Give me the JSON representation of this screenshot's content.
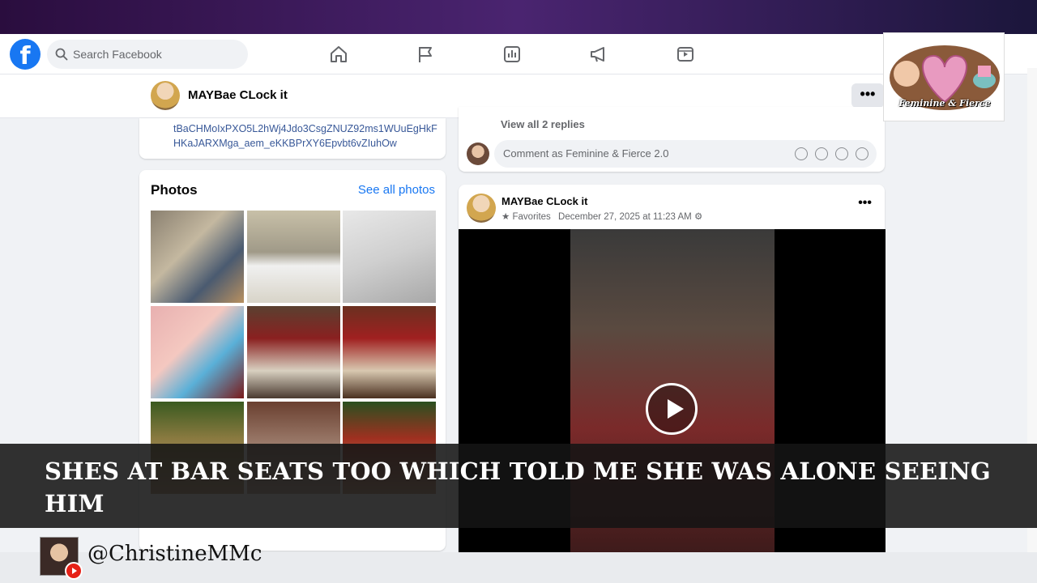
{
  "search": {
    "placeholder": "Search Facebook"
  },
  "nav": {
    "icons": [
      "home-icon",
      "flag-icon",
      "chart-icon",
      "megaphone-icon",
      "video-icon"
    ]
  },
  "profile_bar": {
    "name": "MAYBae CLock it",
    "more_label": "•••"
  },
  "intro_card": {
    "link_text": "tBaCHMoIxPXO5L2hWj4Jdo3CsgZNUZ92ms1WUuEgHkFHKaJARXMga_aem_eKKBPrXY6Epvbt6vZIuhOw"
  },
  "photos": {
    "title": "Photos",
    "see_all": "See all photos"
  },
  "comments": {
    "view_replies": "View all 2 replies",
    "input_placeholder": "Comment as Feminine & Fierce 2.0"
  },
  "post": {
    "author": "MAYBae CLock it",
    "audience": "Favorites",
    "timestamp": "December 27, 2025 at 11:23 AM",
    "more_label": "•••"
  },
  "brand": {
    "logo_text": "Feminine & Fierce"
  },
  "caption": {
    "text": "SHES AT BAR SEATS TOO WHICH TOLD ME SHE WAS ALONE SEEING HIM"
  },
  "channel": {
    "handle": "@ChristineMMc"
  },
  "colors": {
    "fb_blue": "#1877f2",
    "caption_bg": "#141414",
    "youtube_red": "#e62117"
  }
}
